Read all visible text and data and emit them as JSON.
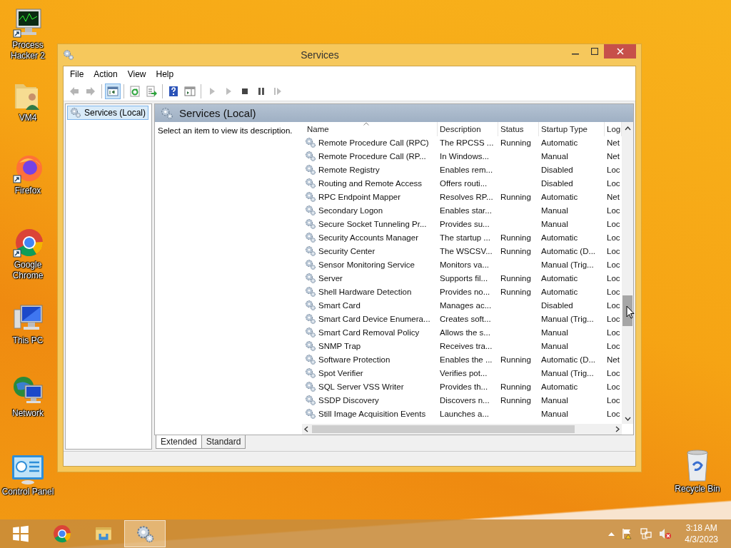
{
  "desktop_icons": [
    {
      "kind": "monitor",
      "label": "Process\nHacker 2"
    },
    {
      "kind": "folder",
      "label": "VM4"
    },
    {
      "kind": "firefox",
      "label": "Firefox"
    },
    {
      "kind": "chrome",
      "label": "Google\nChrome"
    },
    {
      "kind": "computer",
      "label": "This PC"
    },
    {
      "kind": "network",
      "label": "Network"
    },
    {
      "kind": "panel",
      "label": "Control Panel"
    }
  ],
  "recycle_bin": {
    "label": "Recycle Bin"
  },
  "window": {
    "title": "Services",
    "menu": [
      "File",
      "Action",
      "View",
      "Help"
    ],
    "toolbar": [
      {
        "kind": "back",
        "disabled": true
      },
      {
        "kind": "forward",
        "disabled": true
      },
      {
        "kind": "separator"
      },
      {
        "kind": "tree",
        "selected": true
      },
      {
        "kind": "separator"
      },
      {
        "kind": "refresh",
        "disabled": false
      },
      {
        "kind": "export",
        "disabled": false
      },
      {
        "kind": "separator"
      },
      {
        "kind": "help",
        "disabled": false
      },
      {
        "kind": "pane",
        "disabled": false
      },
      {
        "kind": "separator"
      },
      {
        "kind": "start",
        "disabled": true
      },
      {
        "kind": "start",
        "disabled": true
      },
      {
        "kind": "stop",
        "disabled": false
      },
      {
        "kind": "pause",
        "disabled": false
      },
      {
        "kind": "resume",
        "disabled": true
      }
    ],
    "tree": [
      {
        "label": "Services (Local)",
        "selected": true
      }
    ],
    "pane_title": "Services (Local)",
    "description": "Select an item to view its description.",
    "columns": [
      "Name",
      "Description",
      "Status",
      "Startup Type",
      "Log"
    ],
    "services": [
      {
        "name": "Remote Procedure Call (RPC)",
        "description": "The RPCSS ...",
        "status": "Running",
        "startup_type": "Automatic",
        "log_on_as": "Net"
      },
      {
        "name": "Remote Procedure Call (RP...",
        "description": "In Windows...",
        "startup_type": "Manual",
        "log_on_as": "Net"
      },
      {
        "name": "Remote Registry",
        "description": "Enables rem...",
        "startup_type": "Disabled",
        "log_on_as": "Loc"
      },
      {
        "name": "Routing and Remote Access",
        "description": "Offers routi...",
        "startup_type": "Disabled",
        "log_on_as": "Loc"
      },
      {
        "name": "RPC Endpoint Mapper",
        "description": "Resolves RP...",
        "status": "Running",
        "startup_type": "Automatic",
        "log_on_as": "Net"
      },
      {
        "name": "Secondary Logon",
        "description": "Enables star...",
        "startup_type": "Manual",
        "log_on_as": "Loc"
      },
      {
        "name": "Secure Socket Tunneling Pr...",
        "description": "Provides su...",
        "startup_type": "Manual",
        "log_on_as": "Loc"
      },
      {
        "name": "Security Accounts Manager",
        "description": "The startup ...",
        "status": "Running",
        "startup_type": "Automatic",
        "log_on_as": "Loc"
      },
      {
        "name": "Security Center",
        "description": "The WSCSV...",
        "status": "Running",
        "startup_type": "Automatic (D...",
        "log_on_as": "Loc"
      },
      {
        "name": "Sensor Monitoring Service",
        "description": "Monitors va...",
        "startup_type": "Manual (Trig...",
        "log_on_as": "Loc"
      },
      {
        "name": "Server",
        "description": "Supports fil...",
        "status": "Running",
        "startup_type": "Automatic",
        "log_on_as": "Loc"
      },
      {
        "name": "Shell Hardware Detection",
        "description": "Provides no...",
        "status": "Running",
        "startup_type": "Automatic",
        "log_on_as": "Loc"
      },
      {
        "name": "Smart Card",
        "description": "Manages ac...",
        "startup_type": "Disabled",
        "log_on_as": "Loc"
      },
      {
        "name": "Smart Card Device Enumera...",
        "description": "Creates soft...",
        "startup_type": "Manual (Trig...",
        "log_on_as": "Loc"
      },
      {
        "name": "Smart Card Removal Policy",
        "description": "Allows the s...",
        "startup_type": "Manual",
        "log_on_as": "Loc"
      },
      {
        "name": "SNMP Trap",
        "description": "Receives tra...",
        "startup_type": "Manual",
        "log_on_as": "Loc"
      },
      {
        "name": "Software Protection",
        "description": "Enables the ...",
        "status": "Running",
        "startup_type": "Automatic (D...",
        "log_on_as": "Net"
      },
      {
        "name": "Spot Verifier",
        "description": "Verifies pot...",
        "startup_type": "Manual (Trig...",
        "log_on_as": "Loc"
      },
      {
        "name": "SQL Server VSS Writer",
        "description": "Provides th...",
        "status": "Running",
        "startup_type": "Automatic",
        "log_on_as": "Loc"
      },
      {
        "name": "SSDP Discovery",
        "description": "Discovers n...",
        "status": "Running",
        "startup_type": "Manual",
        "log_on_as": "Loc"
      },
      {
        "name": "Still Image Acquisition Events",
        "description": "Launches a...",
        "startup_type": "Manual",
        "log_on_as": "Loc"
      }
    ],
    "tabs": [
      {
        "label": "Extended",
        "selected": true
      },
      {
        "label": "Standard",
        "selected": false
      }
    ]
  },
  "taskbar": {
    "items": [
      {
        "kind": "start",
        "selected": false
      },
      {
        "kind": "chrome",
        "selected": false
      },
      {
        "kind": "explorer",
        "selected": false
      },
      {
        "kind": "services",
        "selected": true
      }
    ],
    "time": "3:18 AM",
    "date": "4/3/2023"
  }
}
